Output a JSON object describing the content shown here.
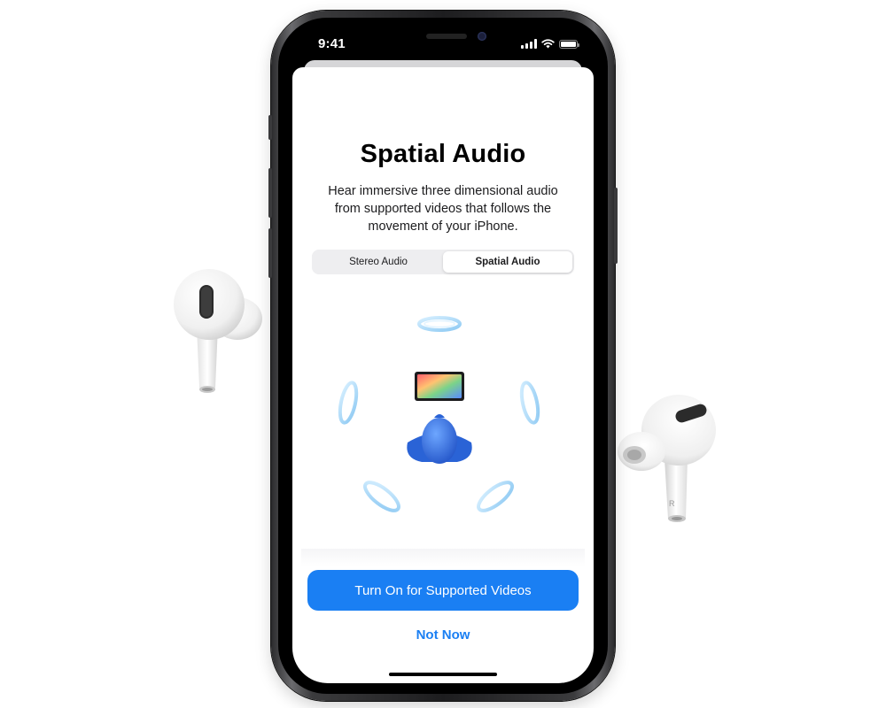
{
  "status_bar": {
    "time": "9:41",
    "icons": [
      "cellular-signal-icon",
      "wifi-icon",
      "battery-icon"
    ]
  },
  "sheet": {
    "title": "Spatial Audio",
    "description_lines": [
      "Hear immersive three dimensional audio",
      "from supported videos that follows the",
      "movement of your iPhone."
    ]
  },
  "segmented_control": {
    "options": [
      "Stereo Audio",
      "Spatial Audio"
    ],
    "selected": "Spatial Audio"
  },
  "buttons": {
    "primary": "Turn On for Supported Videos",
    "secondary": "Not Now"
  },
  "colors": {
    "accent": "#1a7ff3",
    "listener": "#2f6fdc",
    "sound_ring": "#9fd3f7"
  },
  "decor": {
    "left_earbud": "airpod-pro-left",
    "right_earbud": "airpod-pro-right",
    "right_earbud_marking": "R"
  }
}
